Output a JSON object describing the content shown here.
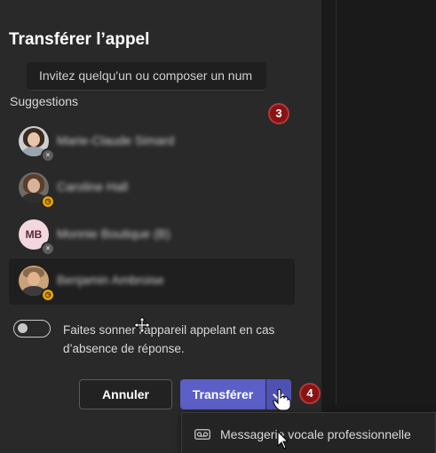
{
  "dialog": {
    "title": "Transférer l’appel",
    "search": {
      "placeholder": "Invitez quelqu'un ou composer un num"
    },
    "suggestions_label": "Suggestions",
    "contacts": [
      {
        "name": "Marie-Claude Simard",
        "presence": "offline",
        "avatar": "photo"
      },
      {
        "name": "Caroline Hall",
        "presence": "away",
        "avatar": "photo"
      },
      {
        "name": "Monnie Boutique (B)",
        "presence": "offline",
        "avatar": "initials",
        "initials": "MB"
      },
      {
        "name": "Benjamin Ambroise",
        "presence": "away",
        "avatar": "photo"
      }
    ],
    "toggle": {
      "label": "Faites sonner l'appareil appelant en cas d’absence de réponse.",
      "checked": false
    },
    "buttons": {
      "cancel": "Annuler",
      "transfer": "Transférer"
    },
    "menu": {
      "items": [
        {
          "label": "Messagerie vocale professionnelle",
          "icon": "voicemail-icon"
        }
      ]
    }
  },
  "annotations": {
    "step_3": "3",
    "step_4": "4"
  },
  "colors": {
    "primary": "#5b5fc7",
    "badge": "#8a1212",
    "away": "#e8a200",
    "offline": "#5c5c5c",
    "dialog_bg": "#292929"
  }
}
